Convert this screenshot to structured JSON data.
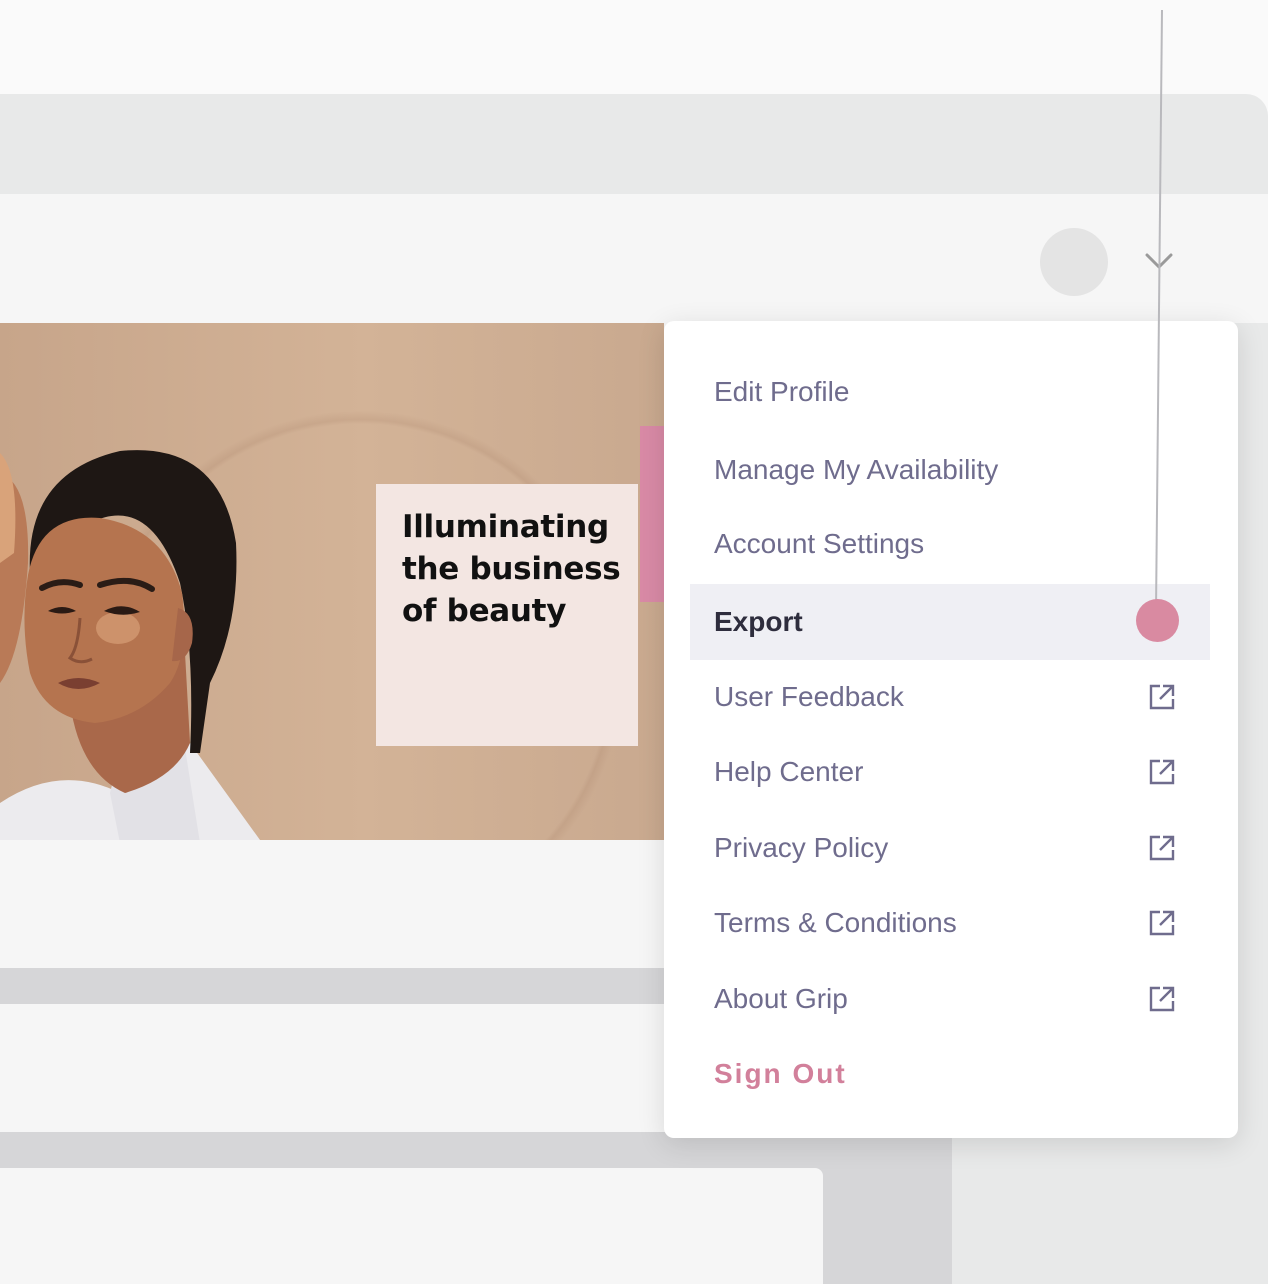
{
  "banner": {
    "headline_lines": [
      "Illuminating",
      "the business",
      "of beauty"
    ]
  },
  "header": {
    "avatar_icon": "avatar-placeholder",
    "menu_toggle_icon": "chevron-down-icon"
  },
  "user_menu": {
    "items": [
      {
        "label": "Edit Profile",
        "external": false,
        "active": false
      },
      {
        "label": "Manage My Availability",
        "external": false,
        "active": false
      },
      {
        "label": "Account Settings",
        "external": false,
        "active": false
      },
      {
        "label": "Export",
        "external": false,
        "active": true
      },
      {
        "label": "User Feedback",
        "external": true,
        "active": false
      },
      {
        "label": "Help Center",
        "external": true,
        "active": false
      },
      {
        "label": "Privacy Policy",
        "external": true,
        "active": false
      },
      {
        "label": "Terms & Conditions",
        "external": true,
        "active": false
      },
      {
        "label": "About Grip",
        "external": true,
        "active": false
      }
    ],
    "sign_out_label": "Sign Out",
    "external_icon": "external-link-icon"
  },
  "colors": {
    "accent_pink": "#d98aa1",
    "menu_text": "#6f6c8d",
    "active_bg": "#efeff4",
    "sign_out": "#d2809b"
  }
}
